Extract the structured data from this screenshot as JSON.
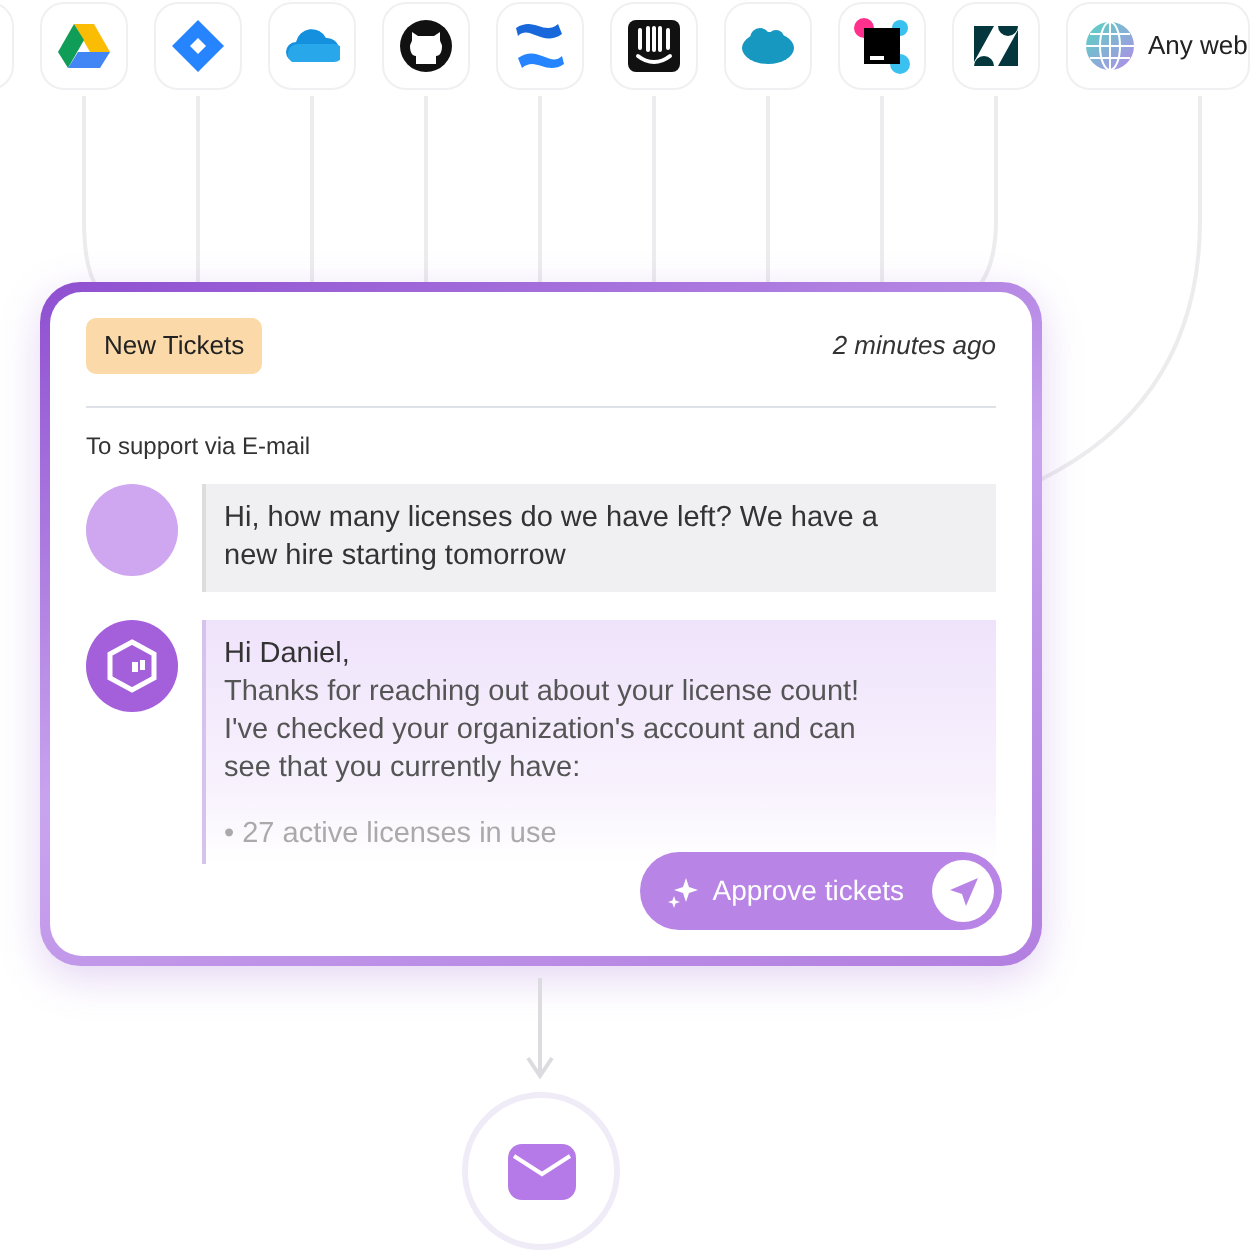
{
  "integrations": [
    {
      "kind": "partial"
    },
    {
      "kind": "drive"
    },
    {
      "kind": "jira"
    },
    {
      "kind": "onedrive"
    },
    {
      "kind": "github"
    },
    {
      "kind": "confluence"
    },
    {
      "kind": "intercom"
    },
    {
      "kind": "salesforce"
    },
    {
      "kind": "youtrack"
    },
    {
      "kind": "zendesk"
    },
    {
      "kind": "globe",
      "label": "Any web"
    }
  ],
  "ticket_card": {
    "badge": "New Tickets",
    "time": "2 minutes ago",
    "channel": "To support via E-mail",
    "messages": [
      {
        "kind": "customer",
        "lines": [
          "Hi, how many licenses do we have left? We have a new hire starting tomorrow"
        ]
      },
      {
        "kind": "assistant",
        "lines": [
          "Hi Daniel,",
          "Thanks for reaching out about your license count! I've checked your organization's account and can see that you currently have:",
          "• 27 active licenses in use"
        ]
      }
    ],
    "action_button": "Approve tickets"
  },
  "destination": {
    "kind": "email"
  }
}
